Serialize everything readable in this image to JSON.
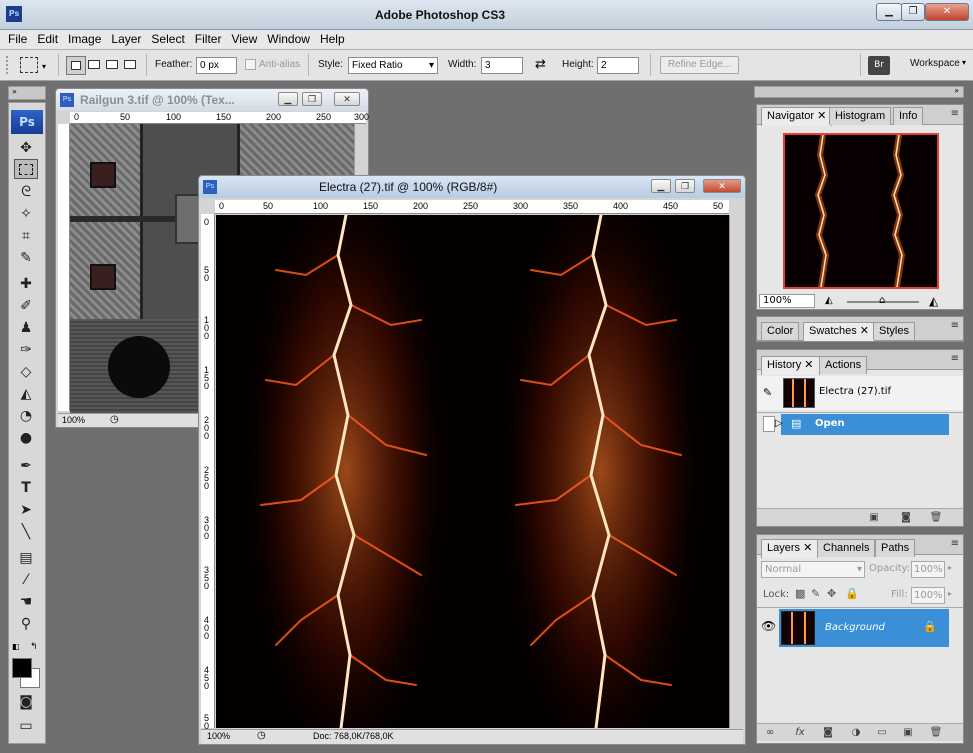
{
  "app": {
    "title": "Adobe Photoshop CS3",
    "logo": "Ps",
    "ps_badge": "Ps"
  },
  "window_controls": {
    "minimize_icon": "minimize-icon",
    "maximize_icon": "maximize-icon",
    "close_icon": "close-icon"
  },
  "menu": [
    "File",
    "Edit",
    "Image",
    "Layer",
    "Select",
    "Filter",
    "View",
    "Window",
    "Help"
  ],
  "options": {
    "feather_label": "Feather:",
    "feather_value": "0 px",
    "antialias_label": "Anti-alias",
    "style_label": "Style:",
    "style_value": "Fixed Ratio",
    "width_label": "Width:",
    "width_value": "3",
    "height_label": "Height:",
    "height_value": "2",
    "refine_edge": "Refine Edge...",
    "workspace": "Workspace"
  },
  "doc1": {
    "title": "Railgun 3.tif @ 100% (Tex...",
    "zoom": "100%",
    "ruler_h": [
      "0",
      "50",
      "100",
      "150",
      "200",
      "250",
      "300"
    ],
    "ruler_v": [
      "0",
      "5\n0",
      "1\n0\n0",
      "1\n5\n0",
      "2\n0\n0",
      "2\n5\n0"
    ]
  },
  "doc2": {
    "title": "Electra (27).tif @ 100% (RGB/8#)",
    "zoom": "100%",
    "doc_info": "Doc: 768,0K/768,0K",
    "ruler_h": [
      "0",
      "50",
      "100",
      "150",
      "200",
      "250",
      "300",
      "350",
      "400",
      "450",
      "50"
    ],
    "ruler_v": [
      "0",
      "5\n0",
      "1\n0\n0",
      "1\n5\n0",
      "2\n0\n0",
      "2\n5\n0",
      "3\n0\n0",
      "3\n5\n0",
      "4\n0\n0",
      "4\n5\n0",
      "5\n0\n0"
    ]
  },
  "navigator": {
    "tabs": [
      "Navigator",
      "Histogram",
      "Info"
    ],
    "zoom": "100%"
  },
  "color_panel": {
    "tabs": [
      "Color",
      "Swatches",
      "Styles"
    ]
  },
  "history": {
    "tabs": [
      "History",
      "Actions"
    ],
    "snapshot": "Electra (27).tif",
    "state": "Open"
  },
  "layers": {
    "tabs": [
      "Layers",
      "Channels",
      "Paths"
    ],
    "blend_mode": "Normal",
    "opacity_label": "Opacity:",
    "opacity_value": "100%",
    "lock_label": "Lock:",
    "fill_label": "Fill:",
    "fill_value": "100%",
    "layer_name": "Background"
  },
  "colors": {
    "selection": "#3a8fd6",
    "titlebar_active": "#c9daf0"
  }
}
